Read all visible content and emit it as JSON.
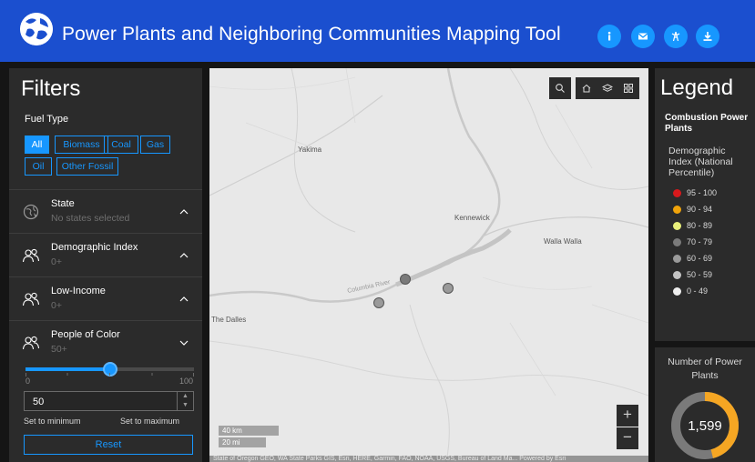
{
  "header": {
    "title": "Power Plants and Neighboring Communities Mapping Tool",
    "buttons": [
      "info-icon",
      "mail-icon",
      "tower-icon",
      "download-icon"
    ]
  },
  "filters": {
    "title": "Filters",
    "fuel_type": {
      "label": "Fuel Type",
      "options": [
        {
          "label": "All",
          "selected": true
        },
        {
          "label": "Biomass",
          "selected": false
        },
        {
          "label": "Coal",
          "selected": false
        },
        {
          "label": "Gas",
          "selected": false
        },
        {
          "label": "Oil",
          "selected": false
        },
        {
          "label": "Other Fossil",
          "selected": false
        }
      ]
    },
    "sections": [
      {
        "title": "State",
        "subtitle": "No states selected",
        "icon": "map-pin-icon",
        "expanded": false
      },
      {
        "title": "Demographic Index",
        "subtitle": "0+",
        "icon": "people-icon",
        "expanded": false
      },
      {
        "title": "Low-Income",
        "subtitle": "0+",
        "icon": "people-icon",
        "expanded": false
      },
      {
        "title": "People of Color",
        "subtitle": "50+",
        "icon": "people-icon",
        "expanded": true
      }
    ],
    "slider": {
      "min_label": "0",
      "max_label": "100",
      "value_fraction": 0.5
    },
    "input_value": "50",
    "set_min_label": "Set to minimum",
    "set_max_label": "Set to maximum",
    "reset_label": "Reset"
  },
  "map": {
    "places": [
      "Yakima",
      "Kennewick",
      "Walla Walla",
      "Columbia River",
      "The Dalles"
    ],
    "scale": {
      "km": "40 km",
      "mi": "20 mi"
    },
    "zoom_in": "+",
    "zoom_out": "−",
    "attribution": "State of Oregon GEO, WA State Parks GIS, Esri, HERE, Garmin, FAO, NOAA, USGS, Bureau of Land Ma...     Powered by Esri",
    "tools": [
      "search-icon",
      "home-icon",
      "layers-icon",
      "basemap-grid-icon"
    ]
  },
  "legend": {
    "title": "Legend",
    "layer": "Combustion Power Plants",
    "field": "Demographic Index (National Percentile)",
    "classes": [
      {
        "label": "95 - 100",
        "color": "#d7191c"
      },
      {
        "label": "90 - 94",
        "color": "#f0a30a"
      },
      {
        "label": "80 - 89",
        "color": "#e8ef7a"
      },
      {
        "label": "70 - 79",
        "color": "#7a7a7a"
      },
      {
        "label": "60 - 69",
        "color": "#9a9a9a"
      },
      {
        "label": "50 - 59",
        "color": "#c4c4c4"
      },
      {
        "label": "0 - 49",
        "color": "#eeeeee"
      }
    ]
  },
  "count": {
    "title": "Number of Power Plants",
    "value": "1,599",
    "fill_fraction": 0.46,
    "colors": {
      "fill": "#f5a623",
      "rest": "#7a7a7a"
    }
  },
  "colors": {
    "header": "#1b4fcf",
    "accent": "#1797ff",
    "panel": "#2b2b2b"
  }
}
